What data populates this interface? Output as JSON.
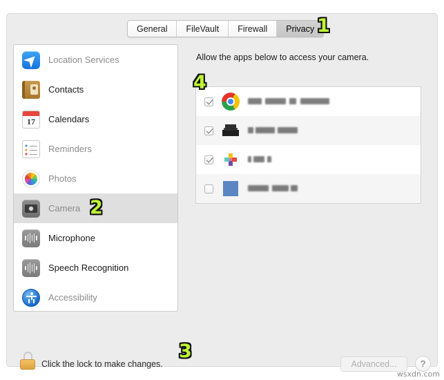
{
  "window": {
    "tabs": [
      {
        "label": "General",
        "selected": false
      },
      {
        "label": "FileVault",
        "selected": false
      },
      {
        "label": "Firewall",
        "selected": false
      },
      {
        "label": "Privacy",
        "selected": true
      }
    ]
  },
  "sidebar": {
    "items": [
      {
        "label": "Location Services",
        "icon": "location-services-icon",
        "enabled": false,
        "selected": false
      },
      {
        "label": "Contacts",
        "icon": "contacts-icon",
        "enabled": true,
        "selected": false
      },
      {
        "label": "Calendars",
        "icon": "calendars-icon",
        "enabled": true,
        "selected": false
      },
      {
        "label": "Reminders",
        "icon": "reminders-icon",
        "enabled": false,
        "selected": false
      },
      {
        "label": "Photos",
        "icon": "photos-icon",
        "enabled": false,
        "selected": false
      },
      {
        "label": "Camera",
        "icon": "camera-icon",
        "enabled": false,
        "selected": true
      },
      {
        "label": "Microphone",
        "icon": "microphone-icon",
        "enabled": true,
        "selected": false
      },
      {
        "label": "Speech Recognition",
        "icon": "speech-recognition-icon",
        "enabled": true,
        "selected": false
      },
      {
        "label": "Accessibility",
        "icon": "accessibility-icon",
        "enabled": false,
        "selected": false
      }
    ]
  },
  "right_pane": {
    "title": "Allow the apps below to access your camera.",
    "app_rows": [
      {
        "checked": true,
        "icon": "chrome-icon",
        "name_redacted": true
      },
      {
        "checked": true,
        "icon": "dark-app-icon",
        "name_redacted": true
      },
      {
        "checked": true,
        "icon": "slack-pinwheel-icon",
        "name_redacted": true
      },
      {
        "checked": false,
        "icon": "person-app-icon",
        "name_redacted": true
      }
    ],
    "clipped_row": {
      "icon": "blue-app-icon"
    }
  },
  "footer": {
    "lock_icon": "closed-lock-icon",
    "lock_text": "Click the lock to make changes.",
    "advanced_label": "Advanced...",
    "help_label": "?"
  },
  "annotations": [
    {
      "id": "1",
      "target": "privacy-tab"
    },
    {
      "id": "2",
      "target": "camera-sidebar-item"
    },
    {
      "id": "3",
      "target": "lock-row"
    },
    {
      "id": "4",
      "target": "app-list"
    }
  ],
  "watermark": "wsxdn.com",
  "colors": {
    "window_bg": "#ececec",
    "panel_bg": "#ffffff",
    "selected_row": "#dfdfdf",
    "annotation": "#bff536",
    "lock_gold": "#e0a23e"
  }
}
